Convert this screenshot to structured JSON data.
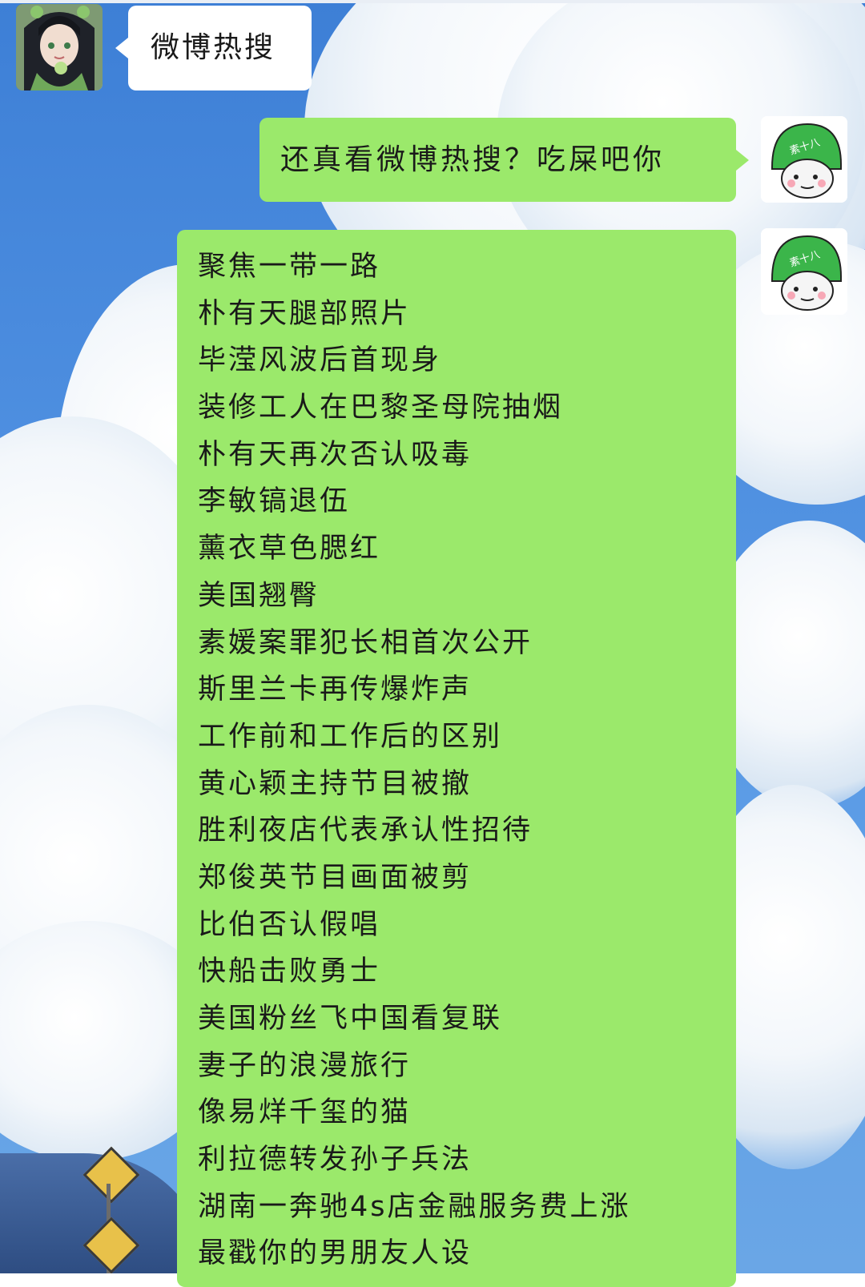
{
  "messages": {
    "incoming": {
      "text": "微博热搜"
    },
    "reply": {
      "text": "还真看微博热搜？吃屎吧你"
    },
    "hot_list": {
      "items": [
        "聚焦一带一路",
        "朴有天腿部照片",
        "毕滢风波后首现身",
        "装修工人在巴黎圣母院抽烟",
        "朴有天再次否认吸毒",
        "李敏镐退伍",
        "薰衣草色腮红",
        "美国翘臀",
        "素媛案罪犯长相首次公开",
        "斯里兰卡再传爆炸声",
        "工作前和工作后的区别",
        "黄心颖主持节目被撤",
        "胜利夜店代表承认性招待",
        "郑俊英节目画面被剪",
        "比伯否认假唱",
        "快船击败勇士",
        "美国粉丝飞中国看复联",
        "妻子的浪漫旅行",
        "像易烊千玺的猫",
        "利拉德转发孙子兵法",
        "湖南一奔驰4s店金融服务费上涨",
        "最戳你的男朋友人设"
      ]
    }
  },
  "avatars": {
    "right_badge_text": "素十八"
  },
  "colors": {
    "incoming_bubble": "#ffffff",
    "outgoing_bubble": "#9be96b",
    "helmet_green": "#3bb54a"
  },
  "icons": {
    "incoming_avatar": "anime-girl-avatar-icon",
    "outgoing_avatar": "green-helmet-meme-avatar-icon"
  }
}
